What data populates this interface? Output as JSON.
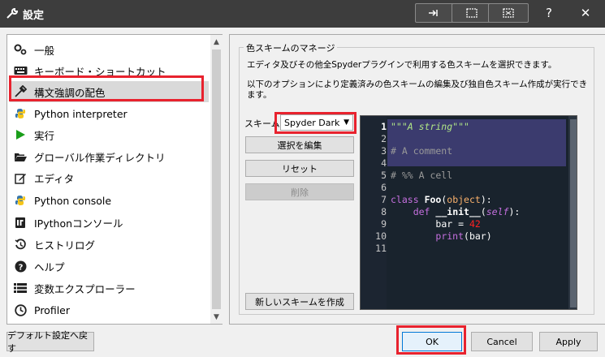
{
  "window": {
    "title": "設定",
    "help_label": "?",
    "close_label": "✕"
  },
  "nav": {
    "items": [
      {
        "label": "一般",
        "icon": "gears-icon"
      },
      {
        "label": "キーボード・ショートカット",
        "icon": "keyboard-icon"
      },
      {
        "label": "構文強調の配色",
        "icon": "eyedropper-icon"
      },
      {
        "label": "Python interpreter",
        "icon": "python-icon"
      },
      {
        "label": "実行",
        "icon": "play-icon"
      },
      {
        "label": "グローバル作業ディレクトリ",
        "icon": "folder-open-icon"
      },
      {
        "label": "エディタ",
        "icon": "edit-icon"
      },
      {
        "label": "Python console",
        "icon": "python-icon"
      },
      {
        "label": "IPythonコンソール",
        "icon": "ipython-icon"
      },
      {
        "label": "ヒストリログ",
        "icon": "history-icon"
      },
      {
        "label": "ヘルプ",
        "icon": "question-circle-icon"
      },
      {
        "label": "変数エクスプローラー",
        "icon": "table-icon"
      },
      {
        "label": "Profiler",
        "icon": "clock-icon"
      }
    ],
    "selected_index": 2
  },
  "scheme_panel": {
    "group_title": "色スキームのマネージ",
    "desc1": "エディタ及びその他全Spyderプラグインで利用する色スキームを選択できます。",
    "desc2": "以下のオプションにより定義済みの色スキームの編集及び独自色スキーム作成が実行できます。",
    "scheme_label": "スキーム",
    "scheme_value": "Spyder Dark",
    "edit_button": "選択を編集",
    "reset_button": "リセット",
    "delete_button": "削除",
    "new_button": "新しいスキームを作成"
  },
  "editor": {
    "line_numbers": [
      "1",
      "2",
      "3",
      "4",
      "5",
      "6",
      "7",
      "8",
      "9",
      "10",
      "11"
    ],
    "line1": "\"\"\"A string\"\"\"",
    "line3": "# A comment",
    "line5": "# %% A cell",
    "line7_kw": "class",
    "line7_name": "Foo",
    "line7_base": "object",
    "line8_kw": "def",
    "line8_name": "__init__",
    "line8_self": "self",
    "line9_var": "bar",
    "line9_num": "42",
    "line10_fn": "print",
    "line10_arg": "bar"
  },
  "footer": {
    "reset_defaults": "デフォルト設定へ戻す",
    "ok": "OK",
    "cancel": "Cancel",
    "apply": "Apply"
  },
  "colors": {
    "highlight_box": "#e8222e",
    "editor_bg": "#19232d",
    "string": "#b0e686",
    "keyword": "#c670e0",
    "number": "#ff2222"
  }
}
